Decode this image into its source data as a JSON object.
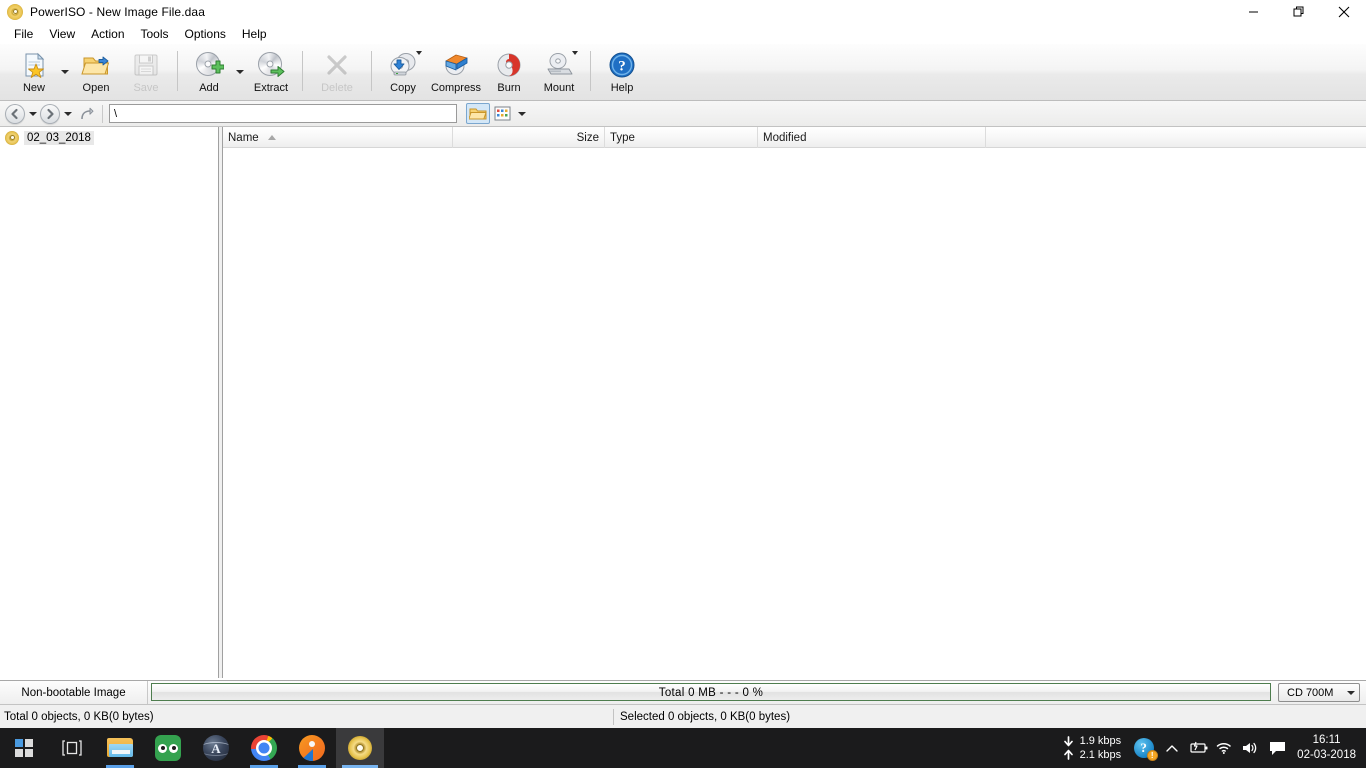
{
  "window": {
    "title": "PowerISO - New Image File.daa",
    "icon": "poweriso-disc-icon",
    "controls": {
      "minimize": "minimize",
      "restore": "restore",
      "close": "close"
    }
  },
  "menu": {
    "items": [
      {
        "label": "File"
      },
      {
        "label": "View"
      },
      {
        "label": "Action"
      },
      {
        "label": "Tools"
      },
      {
        "label": "Options"
      },
      {
        "label": "Help"
      }
    ]
  },
  "toolbar": {
    "buttons": [
      {
        "label": "New",
        "icon": "new-document-star-icon",
        "enabled": true,
        "dropdown": true
      },
      {
        "label": "Open",
        "icon": "open-folder-icon",
        "enabled": true,
        "dropdown": false
      },
      {
        "label": "Save",
        "icon": "floppy-disk-icon",
        "enabled": false,
        "dropdown": false
      },
      {
        "label": "Add",
        "icon": "disc-add-icon",
        "enabled": true,
        "dropdown": true
      },
      {
        "label": "Extract",
        "icon": "disc-extract-icon",
        "enabled": true,
        "dropdown": false
      },
      {
        "label": "Delete",
        "icon": "delete-x-icon",
        "enabled": false,
        "dropdown": false
      },
      {
        "label": "Copy",
        "icon": "disc-copy-icon",
        "enabled": true,
        "dropdown": true
      },
      {
        "label": "Compress",
        "icon": "disc-compress-icon",
        "enabled": true,
        "dropdown": false
      },
      {
        "label": "Burn",
        "icon": "disc-burn-icon",
        "enabled": true,
        "dropdown": false
      },
      {
        "label": "Mount",
        "icon": "disc-mount-icon",
        "enabled": true,
        "dropdown": true
      },
      {
        "label": "Help",
        "icon": "help-circle-icon",
        "enabled": true,
        "dropdown": false
      }
    ]
  },
  "navbar": {
    "back_icon": "back-arrow-icon",
    "forward_icon": "forward-arrow-icon",
    "up_icon": "up-folder-icon",
    "address_value": "\\",
    "open_folder_icon": "open-folder-icon",
    "views_icon": "views-grid-icon"
  },
  "tree": {
    "items": [
      {
        "label": "02_03_2018",
        "icon": "disc-image-icon",
        "selected": true
      }
    ]
  },
  "list": {
    "columns": [
      {
        "label": "Name",
        "sorted": "asc",
        "align": "left"
      },
      {
        "label": "Size",
        "align": "right"
      },
      {
        "label": "Type",
        "align": "left"
      },
      {
        "label": "Modified",
        "align": "left"
      }
    ],
    "rows": []
  },
  "status": {
    "boot_label": "Non-bootable Image",
    "capacity_text": "Total  0 MB   - - -  0 %",
    "size_preset": "CD 700M",
    "total_text": "Total 0 objects, 0 KB(0 bytes)",
    "selected_text": "Selected 0 objects, 0 KB(0 bytes)"
  },
  "taskbar": {
    "start_icon": "windows-start-icon",
    "taskview_icon": "task-view-icon",
    "apps": [
      {
        "name": "file-explorer",
        "icon": "file-explorer-icon",
        "running": true,
        "active": false
      },
      {
        "name": "tripadvisor",
        "icon": "tripadvisor-owl-icon",
        "running": false,
        "active": false
      },
      {
        "name": "globe-app",
        "icon": "globe-app-icon",
        "running": false,
        "active": false
      },
      {
        "name": "google-chrome",
        "icon": "chrome-icon",
        "running": true,
        "active": false
      },
      {
        "name": "orange-app",
        "icon": "orange-app-icon",
        "running": true,
        "active": false
      },
      {
        "name": "poweriso",
        "icon": "poweriso-disc-icon",
        "running": true,
        "active": true
      }
    ],
    "tray": {
      "download_speed": "1.9 kbps",
      "upload_speed": "2.1 kbps",
      "download_icon": "download-arrow-icon",
      "upload_icon": "upload-arrow-icon",
      "help_icon": "help-question-icon",
      "help_badge": "!",
      "chevron_icon": "chevron-up-icon",
      "battery_icon": "battery-charging-icon",
      "wifi_icon": "wifi-icon",
      "volume_icon": "volume-icon",
      "action_center_icon": "action-center-icon",
      "time": "16:11",
      "date": "02-03-2018"
    }
  }
}
